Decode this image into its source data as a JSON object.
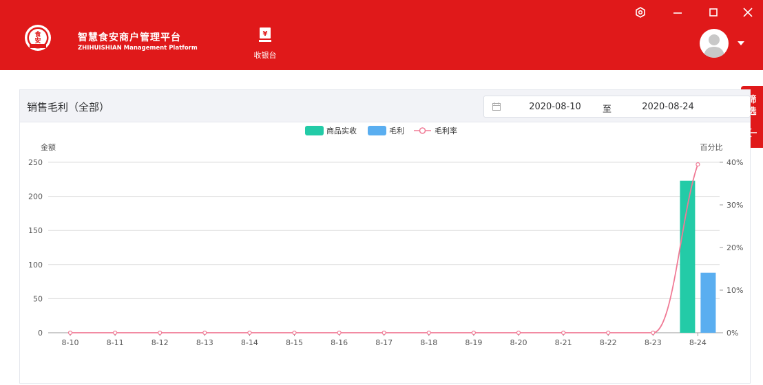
{
  "header": {
    "brand_title": "智慧食安商户管理平台",
    "brand_subtitle": "ZHIHUISHIAN Management Platform",
    "logo_text_top": "食",
    "logo_text_bottom": "安",
    "cashier_label": "收银台",
    "bg_color": "#e0191a"
  },
  "panel": {
    "title": "销售毛利（全部）",
    "date_start": "2020-08-10",
    "date_sep": "至",
    "date_end": "2020-08-24"
  },
  "filter_tab": {
    "label_line1": "筛",
    "label_line2": "选"
  },
  "chart_data": {
    "type": "bar",
    "categories": [
      "8-10",
      "8-11",
      "8-12",
      "8-13",
      "8-14",
      "8-15",
      "8-16",
      "8-17",
      "8-18",
      "8-19",
      "8-20",
      "8-21",
      "8-22",
      "8-23",
      "8-24"
    ],
    "series": [
      {
        "name": "商品实收",
        "type": "bar",
        "axis": "left",
        "color": "#23cba7",
        "values": [
          0,
          0,
          0,
          0,
          0,
          0,
          0,
          0,
          0,
          0,
          0,
          0,
          0,
          0,
          223
        ]
      },
      {
        "name": "毛利",
        "type": "bar",
        "axis": "left",
        "color": "#5aaef0",
        "values": [
          0,
          0,
          0,
          0,
          0,
          0,
          0,
          0,
          0,
          0,
          0,
          0,
          0,
          0,
          88
        ]
      },
      {
        "name": "毛利率",
        "type": "line",
        "axis": "right",
        "color": "#f07b96",
        "values": [
          0,
          0,
          0,
          0,
          0,
          0,
          0,
          0,
          0,
          0,
          0,
          0,
          0,
          0,
          39.5
        ]
      }
    ],
    "ylabel_left": "金额",
    "ylabel_right": "百分比",
    "ylim_left": [
      0,
      250
    ],
    "yticks_left": [
      0,
      50,
      100,
      150,
      200,
      250
    ],
    "ylim_right": [
      0,
      40
    ],
    "yticks_right": [
      "0%",
      "10%",
      "20%",
      "30%",
      "40%"
    ],
    "grid": true,
    "legend": "top-center"
  }
}
